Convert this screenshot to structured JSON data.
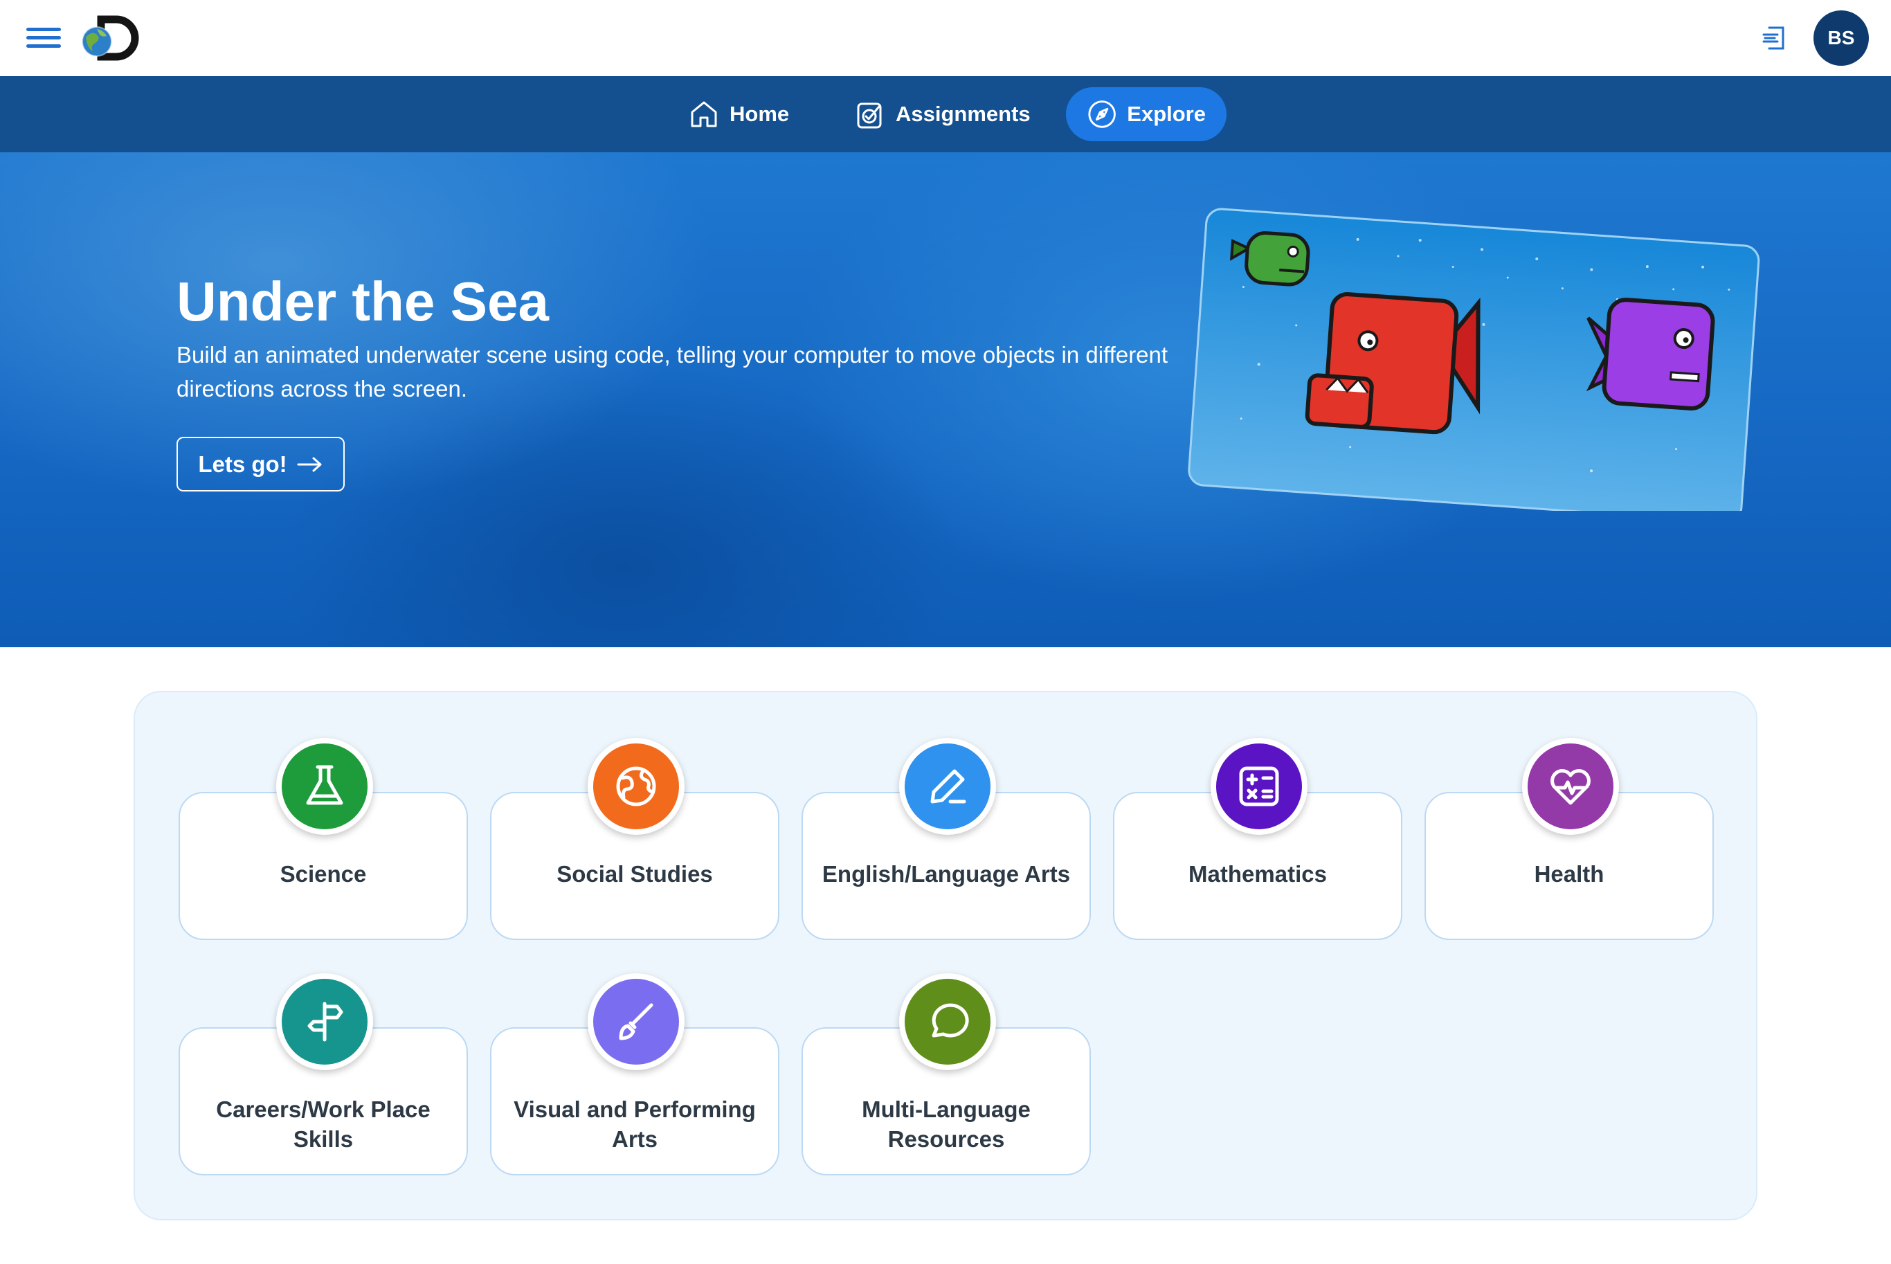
{
  "header": {
    "avatar_initials": "BS"
  },
  "nav": {
    "items": [
      {
        "label": "Home",
        "icon": "home-icon",
        "active": false
      },
      {
        "label": "Assignments",
        "icon": "assignments-icon",
        "active": false
      },
      {
        "label": "Explore",
        "icon": "compass-icon",
        "active": true
      }
    ]
  },
  "hero": {
    "title": "Under the Sea",
    "description": "Build an animated underwater scene using code, telling your computer to move objects in different directions across the screen.",
    "cta_label": "Lets go!"
  },
  "subjects": [
    {
      "label": "Science",
      "icon": "flask-icon",
      "color": "#1e9b3a"
    },
    {
      "label": "Social Studies",
      "icon": "globe-icon",
      "color": "#f26a1b"
    },
    {
      "label": "English/Language Arts",
      "icon": "pencil-icon",
      "color": "#2e92ee"
    },
    {
      "label": "Mathematics",
      "icon": "calculator-icon",
      "color": "#5b14c4"
    },
    {
      "label": "Health",
      "icon": "heart-pulse-icon",
      "color": "#933aa8"
    },
    {
      "label": "Careers/Work Place Skills",
      "icon": "signpost-icon",
      "color": "#16958f"
    },
    {
      "label": "Visual and Performing Arts",
      "icon": "paintbrush-icon",
      "color": "#7b6df0"
    },
    {
      "label": "Multi-Language Resources",
      "icon": "chat-bubble-icon",
      "color": "#5f8f1a"
    }
  ],
  "colors": {
    "nav_bg": "#14508f",
    "nav_active": "#1e78e4",
    "avatar_bg": "#0e3a6e",
    "panel_bg": "#eef6fd",
    "hero_bg": "#1a6fc8"
  }
}
